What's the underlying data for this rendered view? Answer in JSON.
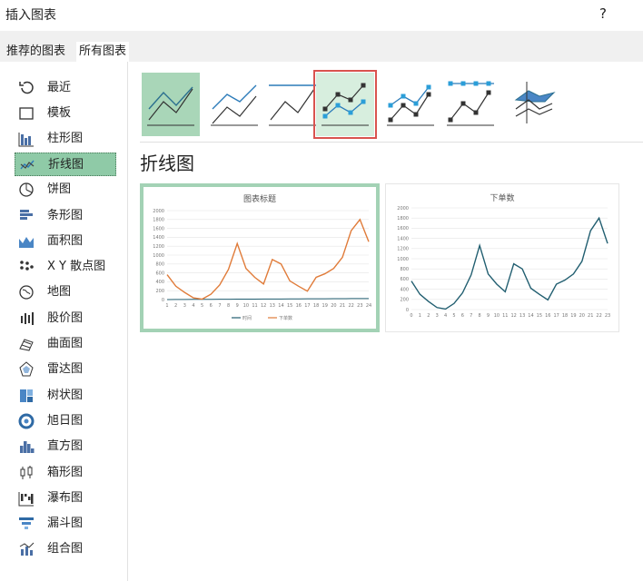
{
  "window": {
    "title": "插入图表",
    "help": "?"
  },
  "tabs": [
    {
      "label": "推荐的图表"
    },
    {
      "label": "所有图表"
    }
  ],
  "sidebar": {
    "items": [
      {
        "label": "最近",
        "icon": "recent-icon"
      },
      {
        "label": "模板",
        "icon": "template-icon"
      },
      {
        "label": "柱形图",
        "icon": "column-chart-icon"
      },
      {
        "label": "折线图",
        "icon": "line-chart-icon",
        "selected": true
      },
      {
        "label": "饼图",
        "icon": "pie-chart-icon"
      },
      {
        "label": "条形图",
        "icon": "bar-chart-icon"
      },
      {
        "label": "面积图",
        "icon": "area-chart-icon"
      },
      {
        "label": "X Y 散点图",
        "icon": "scatter-chart-icon"
      },
      {
        "label": "地图",
        "icon": "map-chart-icon"
      },
      {
        "label": "股价图",
        "icon": "stock-chart-icon"
      },
      {
        "label": "曲面图",
        "icon": "surface-chart-icon"
      },
      {
        "label": "雷达图",
        "icon": "radar-chart-icon"
      },
      {
        "label": "树状图",
        "icon": "treemap-chart-icon"
      },
      {
        "label": "旭日图",
        "icon": "sunburst-chart-icon"
      },
      {
        "label": "直方图",
        "icon": "histogram-chart-icon"
      },
      {
        "label": "箱形图",
        "icon": "box-chart-icon"
      },
      {
        "label": "瀑布图",
        "icon": "waterfall-chart-icon"
      },
      {
        "label": "漏斗图",
        "icon": "funnel-chart-icon"
      },
      {
        "label": "组合图",
        "icon": "combo-chart-icon"
      }
    ]
  },
  "subtypes": [
    {
      "name": "line",
      "selected": true
    },
    {
      "name": "stacked-line"
    },
    {
      "name": "100-stacked-line"
    },
    {
      "name": "line-with-markers",
      "hovered": true
    },
    {
      "name": "stacked-line-with-markers"
    },
    {
      "name": "100-stacked-line-with-markers"
    },
    {
      "name": "3d-line"
    }
  ],
  "section_title": "折线图",
  "colors": {
    "accent": "#a3d2b5",
    "series_orange": "#e07b39",
    "series_teal": "#215e70",
    "hover_border": "#d9534f"
  },
  "chart_data": [
    {
      "type": "line",
      "title": "图表标题",
      "x": [
        1,
        2,
        3,
        4,
        5,
        6,
        7,
        8,
        9,
        10,
        11,
        12,
        13,
        14,
        15,
        16,
        17,
        18,
        19,
        20,
        21,
        22,
        23,
        24
      ],
      "ylim": [
        0,
        2000
      ],
      "yticks": [
        0,
        200,
        400,
        600,
        800,
        1000,
        1200,
        1400,
        1600,
        1800,
        2000
      ],
      "series": [
        {
          "name": "时间",
          "values": [
            1,
            2,
            3,
            4,
            5,
            6,
            7,
            8,
            9,
            10,
            11,
            12,
            13,
            14,
            15,
            16,
            17,
            18,
            19,
            20,
            21,
            22,
            23,
            24
          ]
        },
        {
          "name": "下单数",
          "values": [
            560,
            300,
            160,
            40,
            10,
            120,
            330,
            680,
            1260,
            700,
            500,
            350,
            900,
            800,
            420,
            300,
            190,
            500,
            580,
            700,
            950,
            1550,
            1800,
            1300
          ]
        }
      ],
      "legend": "bottom"
    },
    {
      "type": "line",
      "title": "下单数",
      "x": [
        0,
        1,
        2,
        3,
        4,
        5,
        6,
        7,
        8,
        9,
        10,
        11,
        12,
        13,
        14,
        15,
        16,
        17,
        18,
        19,
        20,
        21,
        22,
        23
      ],
      "ylim": [
        0,
        2000
      ],
      "yticks": [
        0,
        200,
        400,
        600,
        800,
        1000,
        1200,
        1400,
        1600,
        1800,
        2000
      ],
      "series": [
        {
          "values": [
            560,
            300,
            160,
            40,
            10,
            120,
            330,
            680,
            1260,
            700,
            500,
            350,
            900,
            800,
            420,
            300,
            190,
            500,
            580,
            700,
            950,
            1550,
            1800,
            1300
          ]
        }
      ]
    }
  ]
}
